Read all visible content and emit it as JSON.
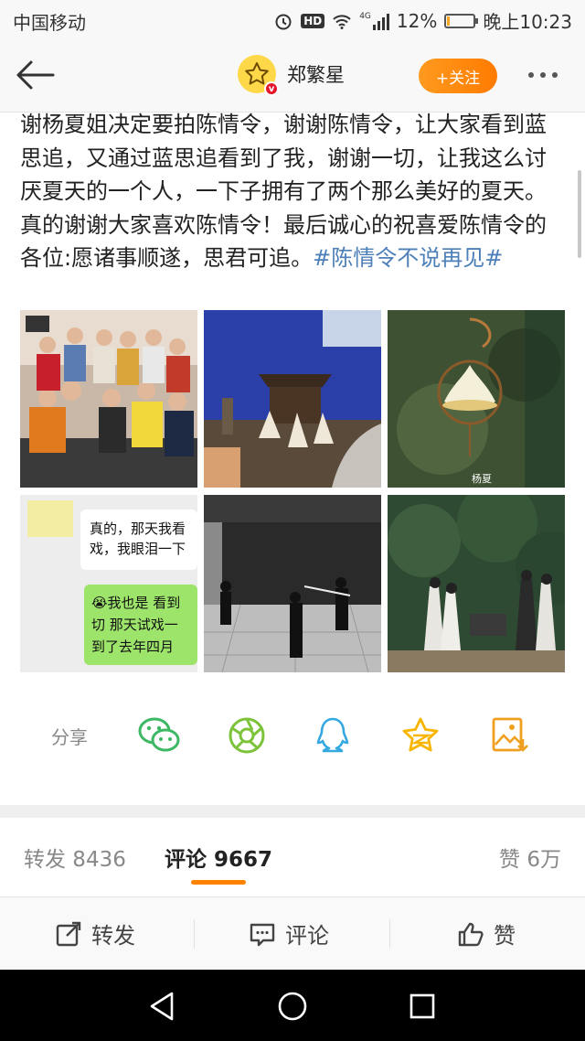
{
  "status_bar": {
    "carrier": "中国移动",
    "signal_label": "4G",
    "battery_percent": "12%",
    "time": "晚上10:23",
    "battery_level": 0.12
  },
  "nav": {
    "author_name": "郑繁星",
    "follow_label": "+关注",
    "accent_color": "#ff8200"
  },
  "post": {
    "text": "谢杨夏姐决定要拍陈情令，谢谢陈情令，让大家看到蓝思追，又通过蓝思追看到了我，谢谢一切，让我这么讨厌夏天的一个人，一下子拥有了两个那么美好的夏天。真的谢谢大家喜欢陈情令！最后诚心的祝喜爱陈情令的各位:愿诸事顺遂，思君可追。",
    "hashtag": "#陈情令不说再见#",
    "hashtag_color": "#4d7fb8",
    "photos": [
      {
        "icon": "group-photo"
      },
      {
        "icon": "film-set-photo"
      },
      {
        "icon": "lotus-lamp-photo",
        "watermark": "杨夏"
      },
      {
        "icon": "chat-screenshot-photo",
        "chat_lines": [
          "真的，那天我看",
          "戏，我眼泪一下"
        ],
        "reply_lines": [
          "😭我也是 看到",
          "切 那天试戏一",
          "到了去年四月"
        ]
      },
      {
        "icon": "rehearsal-photo"
      },
      {
        "icon": "forest-still-photo"
      }
    ]
  },
  "share": {
    "label": "分享",
    "targets": [
      "wechat-icon",
      "moments-icon",
      "qq-icon",
      "qzone-icon",
      "save-image-icon"
    ]
  },
  "tabs": {
    "repost": "转发 8436",
    "comments": "评论 9667",
    "likes": "赞 6万"
  },
  "actions": {
    "repost": "转发",
    "comment": "评论",
    "like": "赞"
  }
}
